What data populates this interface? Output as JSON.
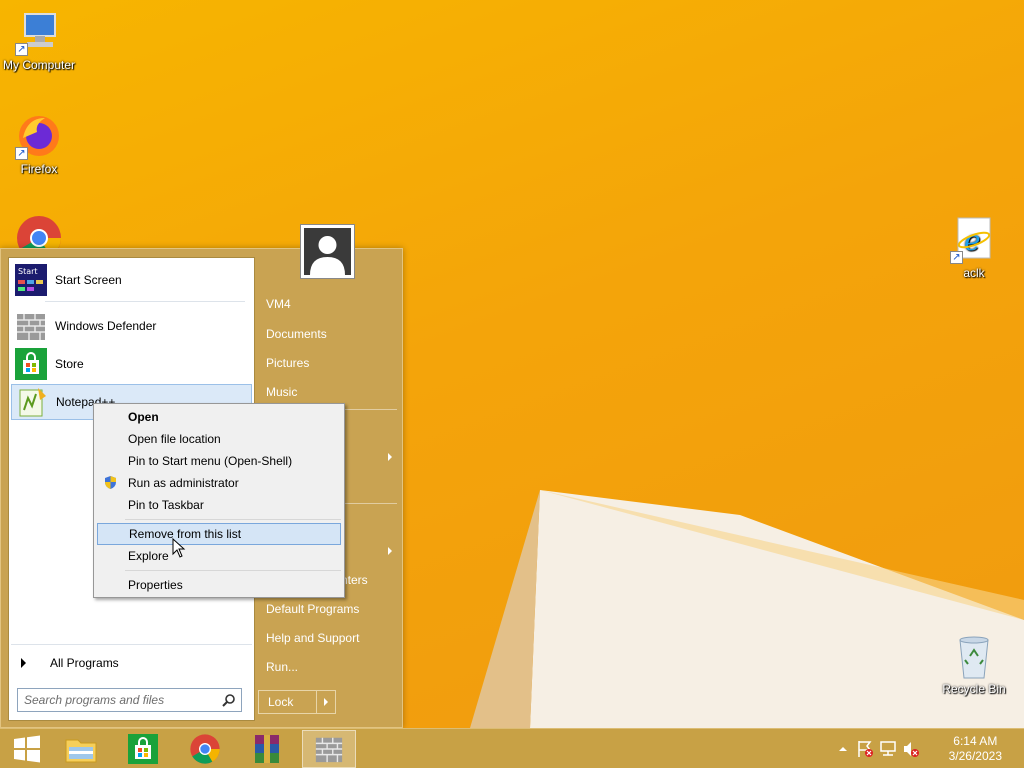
{
  "desktop": {
    "icons": [
      {
        "label": "My Computer",
        "icon": "computer-icon"
      },
      {
        "label": "Firefox",
        "icon": "firefox-icon"
      },
      {
        "label": "Chrome",
        "icon": "chrome-icon"
      },
      {
        "label": "aclk",
        "icon": "internet-explorer-icon"
      },
      {
        "label": "Recycle Bin",
        "icon": "recycle-bin-icon"
      }
    ]
  },
  "start_menu": {
    "pinned": [
      {
        "label": "Start Screen",
        "icon": "start-screen-icon"
      },
      {
        "label": "Windows Defender",
        "icon": "windows-defender-icon"
      },
      {
        "label": "Store",
        "icon": "store-icon"
      },
      {
        "label": "Notepad++",
        "icon": "notepad-plus-plus-icon"
      }
    ],
    "all_programs": "All Programs",
    "search_placeholder": "Search programs and files",
    "right": {
      "user": "VM4",
      "items": [
        "Documents",
        "Pictures",
        "Music"
      ],
      "partial_item": "nters",
      "lower_items": [
        "Default Programs",
        "Help and Support",
        "Run..."
      ],
      "lock": "Lock"
    }
  },
  "context_menu": {
    "items": [
      {
        "label": "Open",
        "bold": true
      },
      {
        "label": "Open file location"
      },
      {
        "label": "Pin to Start menu (Open-Shell)"
      },
      {
        "label": "Run as administrator",
        "icon": "uac-shield-icon"
      },
      {
        "label": "Pin to Taskbar"
      },
      {
        "label": "Remove from this list",
        "highlighted": true
      },
      {
        "label": "Explore"
      },
      {
        "label": "Properties"
      }
    ]
  },
  "taskbar": {
    "buttons": [
      "start-button",
      "file-explorer-icon",
      "store-icon",
      "chrome-icon",
      "winrar-icon",
      "windows-defender-icon"
    ],
    "clock": {
      "time": "6:14 AM",
      "date": "3/26/2023"
    }
  },
  "colors": {
    "desktop": "#f4a40a",
    "start_menu": "#c9a352",
    "taskbar": "#c8a145",
    "highlight": "#d5e5f6"
  }
}
